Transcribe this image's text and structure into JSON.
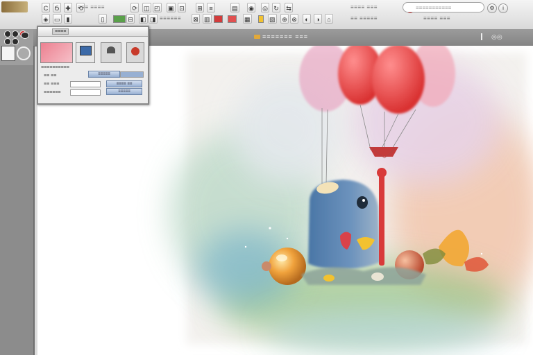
{
  "toolbar": {
    "row1_buttons": [
      "C",
      "Ϭ",
      "✚",
      "⟲",
      "⟳",
      "◫",
      "◰",
      "▣",
      "⊡",
      "⊞",
      "≡",
      "▤",
      "◉",
      "◎",
      "↻",
      "⇆"
    ],
    "row1_labels": [
      "≡≡≡ ≡≡≡≡",
      "≡≡≡≡ ≡≡≡"
    ],
    "row2_buttons": [
      "◈",
      "▭",
      "▮",
      "▯",
      "⊟",
      "◧",
      "◨",
      "⊠",
      "▥",
      "▦",
      "▧",
      "⊕",
      "⊗",
      "◐",
      "◑",
      "⌂"
    ],
    "row2_labels": [
      "≡≡≡≡≡≡",
      "≡≡ ≡≡≡≡≡",
      "≡≡≡≡ ≡≡≡"
    ],
    "search_placeholder": "≡≡≡≡≡≡≡≡≡≡≡",
    "swatch_colors": [
      "#d23b3b",
      "#e05050",
      "#f2c230",
      "#5aa04a"
    ]
  },
  "document": {
    "title": "≡≡≡≡≡≡≡ ≡≡≡"
  },
  "panel": {
    "header": "≡≡≡≡",
    "labels": [
      "≡≡≡≡≡≡≡≡≡≡",
      "≡≡ ≡≡",
      "≡≡ ≡≡≡",
      "≡≡≡≡≡≡"
    ],
    "button_labels": [
      "≡≡≡≡≡",
      "≡≡≡≡ ≡≡",
      "≡≡≡≡≡"
    ],
    "thumb_colors": [
      "#ec8090",
      "#3c6aa8",
      "#7a7a7a",
      "#c83a2a"
    ]
  },
  "illustration": {
    "balloon_colors": [
      "#e94a4a",
      "#f08080",
      "#e8a0b4"
    ],
    "creature_color": "#5a7fa6"
  }
}
